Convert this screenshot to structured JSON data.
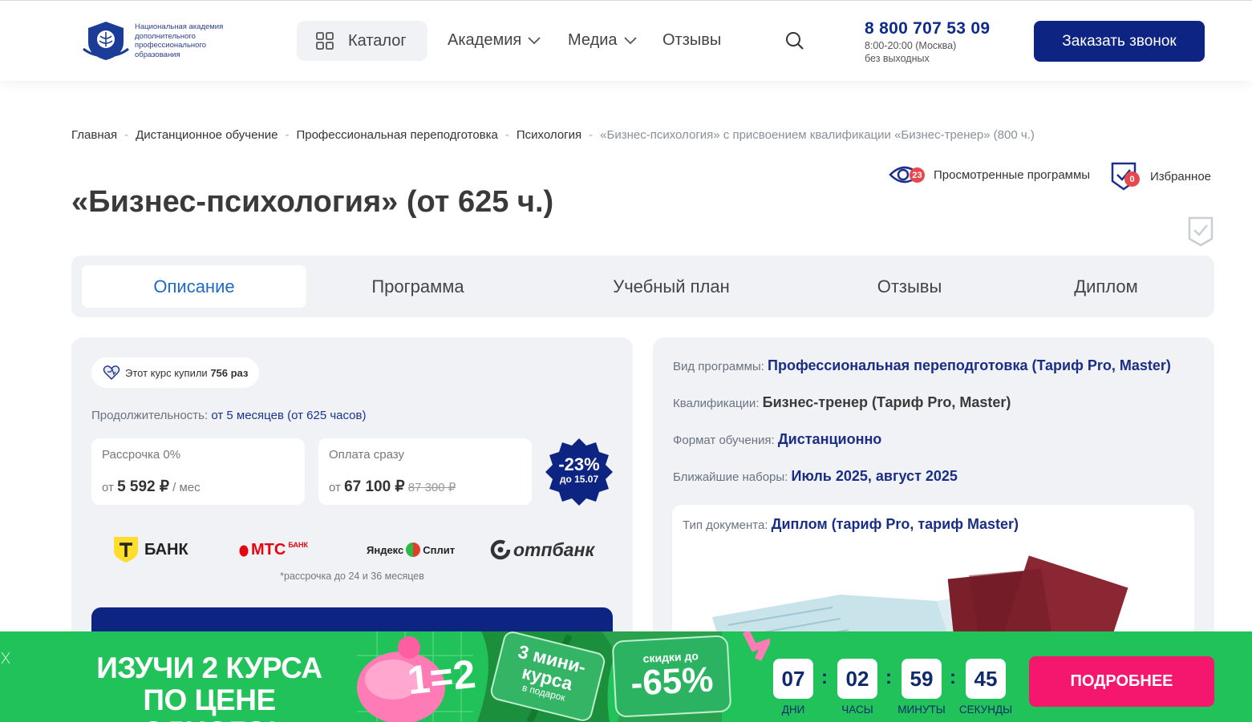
{
  "header": {
    "logo_text": "Национальная академия дополнительного профессионального образования",
    "catalog_label": "Каталог",
    "nav": [
      {
        "label": "Академия"
      },
      {
        "label": "Медиа"
      },
      {
        "label": "Отзывы"
      }
    ],
    "phone": "8 800 707 53 09",
    "phone_hours": "8:00-20:00 (Москва)",
    "phone_days": "без выходных",
    "call_button": "Заказать звонок"
  },
  "breadcrumb": [
    "Главная",
    "Дистанционное обучение",
    "Профессиональная переподготовка",
    "Психология",
    "«Бизнес-психология» с присвоением квалификации «Бизнес-тренер» (800 ч.)"
  ],
  "viewed": {
    "label": "Просмотренные программы",
    "count": "23"
  },
  "favorites": {
    "label": "Избранное",
    "count": "0"
  },
  "page_title": "«Бизнес-психология» (от 625 ч.)",
  "tabs": [
    {
      "label": "Описание"
    },
    {
      "label": "Программа"
    },
    {
      "label": "Учебный план"
    },
    {
      "label": "Отзывы"
    },
    {
      "label": "Диплом"
    }
  ],
  "pricing": {
    "bought_prefix": "Этот курс купили",
    "bought_count": "756 раз",
    "duration_label": "Продолжительность:",
    "duration_value": "от 5 месяцев (от 625 часов)",
    "installment_label": "Рассрочка 0%",
    "installment_from": "от",
    "installment_price": "5 592 ₽",
    "installment_unit": "/ мес",
    "full_label": "Оплата сразу",
    "full_from": "от",
    "full_price": "67 100 ₽",
    "full_old_price": "87 300 ₽",
    "discount_percent": "-23%",
    "discount_until": "до 15.07",
    "banks": [
      "БАНК",
      "МТС",
      "БАНК",
      "Яндекс",
      "Сплит",
      "отпбанк"
    ],
    "footnote": "*рассрочка до 24 и 36 месяцев"
  },
  "program_info": {
    "type_label": "Вид программы:",
    "type_value": "Профессиональная переподготовка (Тариф Pro, Master)",
    "qualification_label": "Квалификации:",
    "qualification_value": "Бизнес-тренер (Тариф Pro, Master)",
    "format_label": "Формат обучения:",
    "format_value": "Дистанционно",
    "intake_label": "Ближайшие наборы:",
    "intake_value": "Июль 2025, август 2025",
    "doc_label": "Тип документа:",
    "doc_value": "Диплом (тариф Pro, тариф Master)"
  },
  "promo": {
    "title_line1": "ИЗУЧИ 2 КУРСА",
    "title_line2": "ПО ЦЕНЕ ОДНОГО!",
    "sticker_equal": "1=2",
    "sticker_mini": "3 мини-курса",
    "sticker_gift": "в подарок",
    "sticker_disc_top": "скидки до",
    "sticker_disc": "-65%",
    "timer": [
      {
        "value": "07",
        "label": "ДНИ"
      },
      {
        "value": "02",
        "label": "ЧАСЫ"
      },
      {
        "value": "59",
        "label": "МИНУТЫ"
      },
      {
        "value": "45",
        "label": "СЕКУНДЫ"
      }
    ],
    "button": "ПОДРОБНЕЕ"
  },
  "colors": {
    "brand_navy": "#0d2482",
    "link_blue": "#1e6ac9",
    "promo_green": "#22c25a",
    "promo_pink": "#f5166e",
    "badge_red": "#e8474d"
  }
}
